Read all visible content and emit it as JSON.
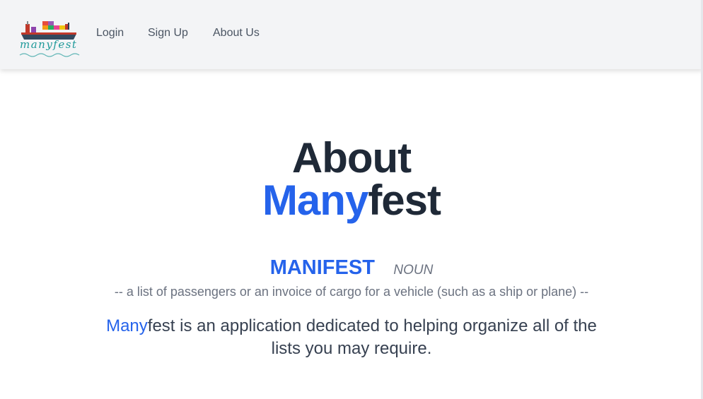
{
  "nav": {
    "logo_text": "manyfest",
    "links": [
      {
        "label": "Login"
      },
      {
        "label": "Sign Up"
      },
      {
        "label": "About Us"
      }
    ]
  },
  "main": {
    "title_line1": "About",
    "title_accent": "Many",
    "title_rest": "fest",
    "word": "MANIFEST",
    "part_of_speech": "NOUN",
    "definition": "-- a list of passengers or an invoice of cargo for a vehicle (such as a ship or plane) --",
    "description_accent": "Many",
    "description_rest": "fest is an application dedicated to helping organize all of the lists you may require."
  },
  "colors": {
    "accent": "#2563eb",
    "heading": "#1f2937",
    "navbar_bg": "#f3f4f6",
    "logo_teal": "#1f9a9a"
  }
}
